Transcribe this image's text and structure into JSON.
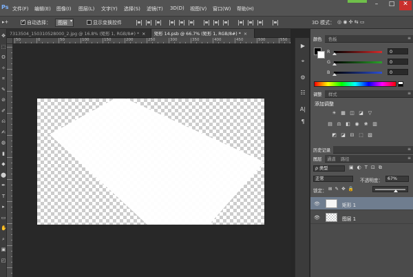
{
  "menubar": {
    "logo": "Ps",
    "items": [
      "文件(F)",
      "编辑(E)",
      "图像(I)",
      "图层(L)",
      "文字(Y)",
      "选择(S)",
      "滤镜(T)",
      "3D(D)",
      "视图(V)",
      "窗口(W)",
      "帮助(H)"
    ],
    "window_buttons": {
      "minimize": "–",
      "maximize": "□",
      "close": "✕"
    }
  },
  "options": {
    "tool_glyph": "▸+",
    "auto_select_label": "自动选择：",
    "auto_select_value": "图层",
    "auto_select_checked": true,
    "show_transform_label": "显示变换控件",
    "show_transform_checked": false,
    "mode_3d_label": "3D 模式："
  },
  "tabs": [
    {
      "label": "7313504_150310528000_2.jpg @ 16.8% (矩形 1, RGB/8#) *",
      "active": false,
      "close": "×"
    },
    {
      "label": "矩形 14.psb @ 66.7% (矩形 1, RGB/8#) *",
      "active": true,
      "close": "×"
    }
  ],
  "ruler": {
    "labels": [
      "50",
      "0",
      "50",
      "100",
      "150",
      "200",
      "250",
      "300",
      "350",
      "400",
      "450",
      "500",
      "550"
    ]
  },
  "color_panel": {
    "tabs": [
      "颜色",
      "色板"
    ],
    "channels": [
      {
        "name": "R",
        "value": "0",
        "color": "#d62b2b"
      },
      {
        "name": "G",
        "value": "0",
        "color": "#29a329"
      },
      {
        "name": "B",
        "value": "0",
        "color": "#2b4fd6"
      }
    ]
  },
  "adjust_panel": {
    "tabs": [
      "调整",
      "样式"
    ],
    "heading": "添加调整",
    "row1": [
      "☀",
      "▦",
      "◫",
      "◪",
      "▽"
    ],
    "row2": [
      "▤",
      "⚖",
      "◧",
      "◉",
      "❀",
      "▥"
    ],
    "row3": [
      "◩",
      "◪",
      "⊟",
      "⬚",
      "▧"
    ]
  },
  "history_panel": {
    "tabs": [
      "历史记录"
    ]
  },
  "layers_panel": {
    "tabs": [
      "图层",
      "通道",
      "路径"
    ],
    "filter_label": "ρ 类型",
    "filter_icons": [
      "▣",
      "◐",
      "T",
      "⊡",
      "⧉"
    ],
    "blend_mode": "正常",
    "opacity_label": "不透明度：",
    "opacity_value": "67%",
    "lock_label": "锁定：",
    "lock_icons": [
      "⊞",
      "✎",
      "✥",
      "🔒"
    ],
    "fill_label": "填充：",
    "layers": [
      {
        "name": "矩形 1",
        "selected": true,
        "kind": "shape"
      },
      {
        "name": "图层 1",
        "selected": false,
        "kind": "raster"
      }
    ]
  },
  "tools": [
    "✥",
    "⬚",
    "ʘ",
    "✧",
    "⌗",
    "✎",
    "⊘",
    "✐",
    "⎌",
    "✍",
    "◍",
    "▮",
    "◆",
    "⬤",
    "✒",
    "T",
    "▸",
    "▭",
    "✋",
    "⌕",
    "▣",
    "◰"
  ],
  "icon_column": [
    "▶",
    "⌖",
    "⚙",
    "☷",
    "A|",
    "¶"
  ],
  "colors": {
    "foreground": "#000000",
    "background": "#ffffff",
    "selected_layer": "#6f7d8f"
  }
}
